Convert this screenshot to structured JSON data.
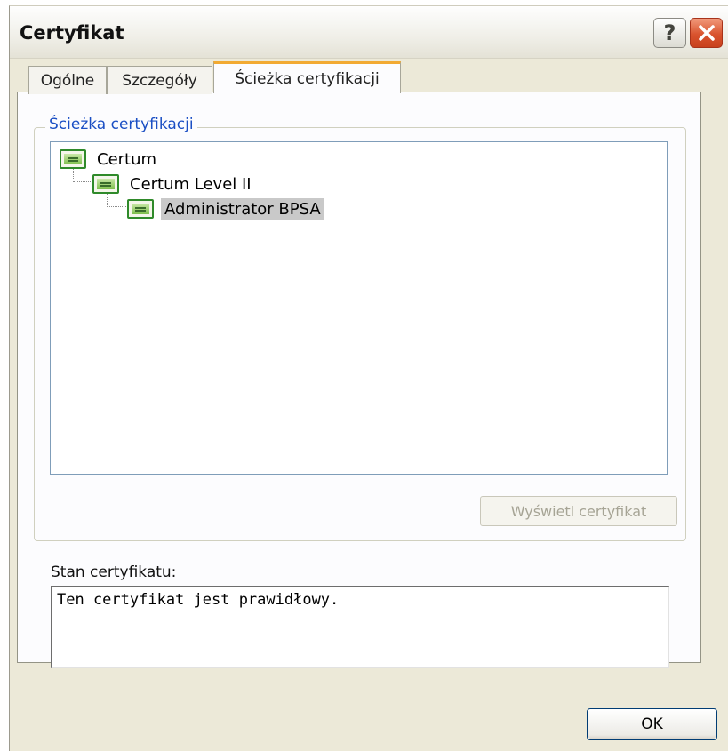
{
  "window": {
    "title": "Certyfikat",
    "help_button": "?",
    "close_button": "close"
  },
  "tabs": [
    {
      "label": "Ogólne",
      "active": false
    },
    {
      "label": "Szczegóły",
      "active": false
    },
    {
      "label": "Ścieżka certyfikacji",
      "active": true
    }
  ],
  "path_group": {
    "legend": "Ścieżka certyfikacji",
    "tree": [
      {
        "label": "Certum",
        "level": 0,
        "selected": false,
        "icon": "certificate-icon"
      },
      {
        "label": "Certum Level II",
        "level": 1,
        "selected": false,
        "icon": "certificate-icon"
      },
      {
        "label": "Administrator BPSA",
        "level": 2,
        "selected": true,
        "icon": "certificate-icon"
      }
    ],
    "view_button": "Wyświetl certyfikat",
    "view_button_enabled": false
  },
  "status": {
    "label": "Stan certyfikatu:",
    "text": "Ten certyfikat jest prawidłowy."
  },
  "footer": {
    "ok_button": "OK"
  },
  "colors": {
    "dialog_bg": "#ece9d8",
    "active_tab_accent": "#f2aa32",
    "legend_text": "#1b4fc4",
    "close_button": "#d9532e",
    "selection_bg": "#c9c9c9"
  }
}
